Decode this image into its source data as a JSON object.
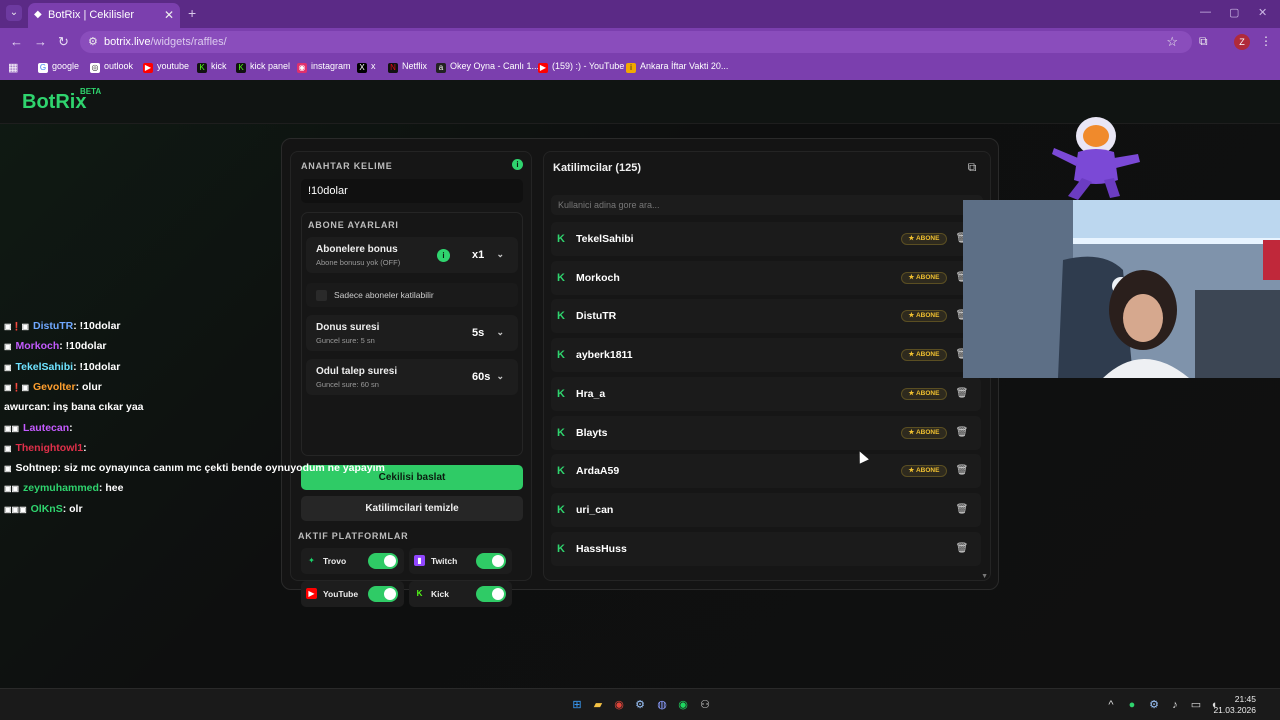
{
  "browser": {
    "tab_title": "BotRix | Cekilisler",
    "url_host": "botrix.live",
    "url_path": "/widgets/raffles/",
    "profile_initial": "Z",
    "bookmarks": [
      {
        "label": "google",
        "icon": "google-icon",
        "color": "#4285f4"
      },
      {
        "label": "outlook",
        "icon": "outlook-icon",
        "color": "#ffffff"
      },
      {
        "label": "youtube",
        "icon": "youtube-icon",
        "color": "#ff0000"
      },
      {
        "label": "kick",
        "icon": "kick-icon",
        "color": "#53fc18"
      },
      {
        "label": "kick panel",
        "icon": "kick-icon",
        "color": "#53fc18"
      },
      {
        "label": "instagram",
        "icon": "instagram-icon",
        "color": "#e1306c"
      },
      {
        "label": "x",
        "icon": "x-icon",
        "color": "#000000"
      },
      {
        "label": "Netflix",
        "icon": "netflix-icon",
        "color": "#e50914"
      },
      {
        "label": "Okey Oyna - Canlı 1...",
        "icon": "okey-icon",
        "color": "#222222"
      },
      {
        "label": "(159) :) - YouTube",
        "icon": "youtube-icon",
        "color": "#ff0000"
      },
      {
        "label": "Ankara İftar Vakti 20...",
        "icon": "site-icon",
        "color": "#f2a900"
      }
    ]
  },
  "app": {
    "logo": "BotRix",
    "logo_badge": "BETA",
    "accent": "#2fd46e"
  },
  "raffle": {
    "keyword_title": "ANAHTAR KELIME",
    "keyword_value": "!10dolar",
    "sub_settings_title": "ABONE AYARLARI",
    "sub_bonus_label": "Abonelere bonus",
    "sub_bonus_sub": "Abone bonusu yok (OFF)",
    "sub_bonus_value": "x1",
    "subs_only_label": "Sadece aboneler katilabilir",
    "bonus_time_label": "Donus suresi",
    "bonus_time_sub": "Guncel sure: 5 sn",
    "bonus_time_value": "5s",
    "claim_time_label": "Odul talep suresi",
    "claim_time_sub": "Guncel sure: 60 sn",
    "claim_time_value": "60s",
    "start_button": "Cekilisi baslat",
    "clear_button": "Katilimcilari temizle",
    "platforms_title": "AKTIF PLATFORMLAR",
    "platforms": [
      {
        "name": "Trovo",
        "icon": "trovo-icon",
        "color": "#19d66b",
        "enabled": true
      },
      {
        "name": "Twitch",
        "icon": "twitch-icon",
        "color": "#9146ff",
        "enabled": true
      },
      {
        "name": "YouTube",
        "icon": "youtube-icon",
        "color": "#ff0000",
        "enabled": true
      },
      {
        "name": "Kick",
        "icon": "kick-icon",
        "color": "#53fc18",
        "enabled": true
      }
    ]
  },
  "participants": {
    "title": "Katilimcilar (125)",
    "search_placeholder": "Kullanici adina gore ara...",
    "badge_label": "ABONE",
    "list": [
      {
        "name": "TekelSahibi",
        "subscriber": true
      },
      {
        "name": "Morkoch",
        "subscriber": true
      },
      {
        "name": "DistuTR",
        "subscriber": true
      },
      {
        "name": "ayberk1811",
        "subscriber": true
      },
      {
        "name": "Hra_a",
        "subscriber": true
      },
      {
        "name": "Blayts",
        "subscriber": true
      },
      {
        "name": "ArdaA59",
        "subscriber": true
      },
      {
        "name": "uri_can",
        "subscriber": false
      },
      {
        "name": "HassHuss",
        "subscriber": false
      }
    ]
  },
  "chat": [
    {
      "user": "DistuTR",
      "color": "#6fa8ff",
      "msg": ": !10dolar",
      "icons": "▣❗▣"
    },
    {
      "user": "Morkoch",
      "color": "#c45bff",
      "msg": ": !10dolar",
      "icons": "▣"
    },
    {
      "user": "TekelSahibi",
      "color": "#6fe3ff",
      "msg": ": !10dolar",
      "icons": "▣"
    },
    {
      "user": "Gevolter",
      "color": "#ff9f2e",
      "msg": ": olur",
      "icons": "▣❗▣"
    },
    {
      "user": "awurcan",
      "color": "#ffffff",
      "msg": ": inş bana cıkar yaa",
      "icons": ""
    },
    {
      "user": "Lautecan",
      "color": "#c45bff",
      "msg": ": ",
      "icons": "▣▣"
    },
    {
      "user": "Thenightowl1",
      "color": "#e0304a",
      "msg": ": ",
      "icons": "▣"
    },
    {
      "user": "Sohtnep",
      "color": "#ffffff",
      "msg": ": siz mc oynayınca canım mc çekti bende oynuyodum ne yapayım",
      "icons": "▣"
    },
    {
      "user": "zeymuhammed",
      "color": "#2fd46e",
      "msg": ": hee",
      "icons": "▣▣"
    },
    {
      "user": "OlKnS",
      "color": "#2fd46e",
      "msg": ": olr",
      "icons": "▣▣▣"
    }
  ],
  "taskbar": {
    "time": "21:45",
    "date": "21.03.2026"
  }
}
